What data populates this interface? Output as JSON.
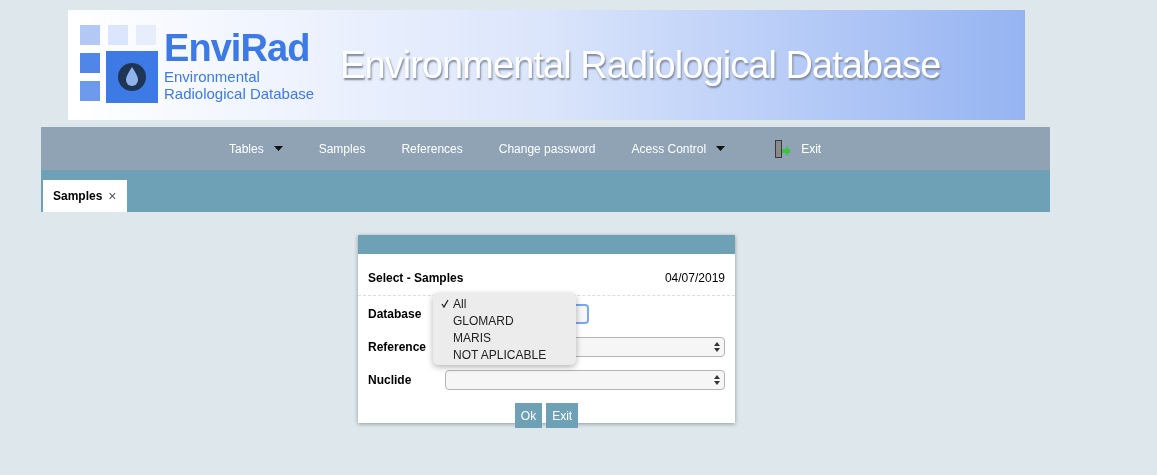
{
  "header": {
    "logo_title": "EnviRad",
    "logo_subtitle": [
      "Environmental",
      "Radiological Database"
    ],
    "banner_title": "Environmental Radiological Database"
  },
  "nav": [
    {
      "label": "Tables",
      "kind": "menu"
    },
    {
      "label": "Samples",
      "kind": "link"
    },
    {
      "label": "References",
      "kind": "link"
    },
    {
      "label": "Change password",
      "kind": "link"
    },
    {
      "label": "Acess Control",
      "kind": "menu"
    },
    {
      "label": "Exit",
      "kind": "exit"
    }
  ],
  "tabs": [
    {
      "label": "Samples",
      "close": "×",
      "selected": true
    }
  ],
  "dialog": {
    "title": "Select - Samples",
    "date": "04/07/2019",
    "fields": [
      {
        "label": "Database",
        "open": true
      },
      {
        "label": "Reference",
        "open": false
      },
      {
        "label": "Nuclide",
        "open": false
      }
    ],
    "dropdown_options": [
      {
        "label": "All",
        "selected": true
      },
      {
        "label": "GLOMARD",
        "selected": false
      },
      {
        "label": "MARIS",
        "selected": false
      },
      {
        "label": "NOT APLICABLE",
        "selected": false
      }
    ],
    "buttons": [
      "Ok",
      "Exit"
    ]
  }
}
